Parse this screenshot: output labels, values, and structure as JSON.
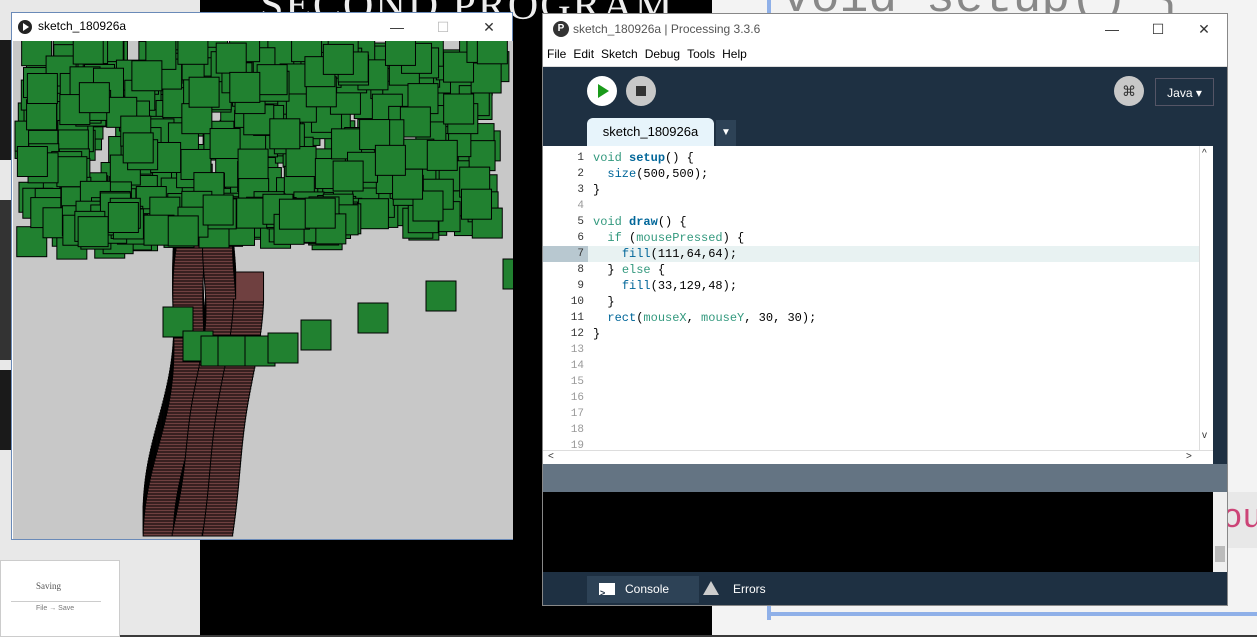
{
  "background": {
    "slide_title": "SECOND PROGRAM",
    "code_fragment": "void setup() {",
    "pink_fragment": "ou",
    "doc_heading": "Saving",
    "doc_sub": "File → Save"
  },
  "sketch_window": {
    "title": "sketch_180926a",
    "minimize": "—",
    "maximize": "☐",
    "close": "✕"
  },
  "ide": {
    "title": "sketch_180926a | Processing 3.3.6",
    "logo": "P",
    "minimize": "—",
    "maximize": "☐",
    "close": "✕",
    "menu": [
      "File",
      "Edit",
      "Sketch",
      "Debug",
      "Tools",
      "Help"
    ],
    "mode": "Java ▾",
    "debug_icon": "⌘",
    "tab_label": "sketch_180926a",
    "tab_arrow": "▼",
    "console_tab": "Console",
    "errors_tab": "Errors",
    "scroll_left": "<",
    "scroll_right": ">",
    "scroll_up": "^",
    "scroll_down": "v"
  },
  "code_lines": [
    {
      "n": "1",
      "html": "<span class='kw'>void</span> <span class='fn'>setup</span>() {"
    },
    {
      "n": "2",
      "html": "  <span class='fn2'>size</span>(500,500);"
    },
    {
      "n": "3",
      "html": "}"
    },
    {
      "n": "4",
      "html": ""
    },
    {
      "n": "5",
      "html": "<span class='kw'>void</span> <span class='fn'>draw</span>() {"
    },
    {
      "n": "6",
      "html": "  <span class='kw'>if</span> (<span class='kw'>mousePressed</span>) {"
    },
    {
      "n": "7",
      "html": "    <span class='fn2'>fill</span>(111,64,64);"
    },
    {
      "n": "8",
      "html": "  } <span class='kw'>else</span> {"
    },
    {
      "n": "9",
      "html": "    <span class='fn2'>fill</span>(33,129,48);"
    },
    {
      "n": "10",
      "html": "  }"
    },
    {
      "n": "11",
      "html": "  <span class='fn2'>rect</span>(<span class='kw'>mouseX</span>, <span class='kw'>mouseY</span>, 30, 30);"
    },
    {
      "n": "12",
      "html": "}"
    },
    {
      "n": "13",
      "html": ""
    },
    {
      "n": "14",
      "html": ""
    },
    {
      "n": "15",
      "html": ""
    },
    {
      "n": "16",
      "html": ""
    },
    {
      "n": "17",
      "html": ""
    },
    {
      "n": "18",
      "html": ""
    },
    {
      "n": "19",
      "html": ""
    }
  ],
  "highlighted_line": 7,
  "colors": {
    "leaf_fill": "#218130",
    "trunk_fill": "#6f4040",
    "canvas_bg": "#c8c8c8"
  }
}
